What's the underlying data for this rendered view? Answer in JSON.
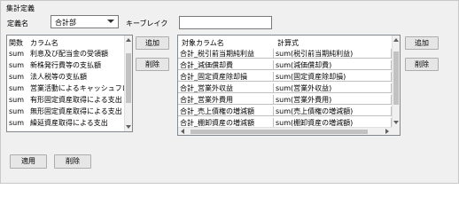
{
  "group_title": "集計定義",
  "definition_label": "定義名",
  "definition_value": "合計部",
  "break_key_label": "キーブレイク",
  "break_key_value": "",
  "left_add_label": "追加",
  "left_delete_label": "削除",
  "right_add_label": "追加",
  "right_delete_label": "削除",
  "apply_label": "適用",
  "bottom_delete_label": "削除",
  "column_list": {
    "headers": [
      "関数",
      "カラム名"
    ],
    "rows": [
      [
        "sum",
        "利息及び配当金の受領額"
      ],
      [
        "sum",
        "新株発行費等の支払額"
      ],
      [
        "sum",
        "法人税等の支払額"
      ],
      [
        "sum",
        "営業活動によるキャッシュフロー"
      ],
      [
        "sum",
        "有形固定資産取得による支出"
      ],
      [
        "sum",
        "無形固定資産取得による支出"
      ],
      [
        "sum",
        "繰延資産取得による支出"
      ]
    ]
  },
  "formula_grid": {
    "headers": [
      "対象カラム名",
      "計算式"
    ],
    "rows": [
      [
        "合計_税引前当期純利益",
        "sum(税引前当期純利益)"
      ],
      [
        "合計_減価償却費",
        "sum(減価償却費)"
      ],
      [
        "合計_固定資産除却損",
        "sum(固定資産除却損)"
      ],
      [
        "合計_営業外収益",
        "sum(営業外収益)"
      ],
      [
        "合計_営業外費用",
        "sum(営業外費用)"
      ],
      [
        "合計_売上債権の増減額",
        "sum(売上債権の増減額)"
      ],
      [
        "合計_棚卸資産の増減額",
        "sum(棚卸資産の増減額)"
      ]
    ]
  },
  "colors": {
    "panel_bg": "#f0f0f0",
    "button_bg": "#e6e6e6",
    "grid_line": "#c0c0c0"
  }
}
